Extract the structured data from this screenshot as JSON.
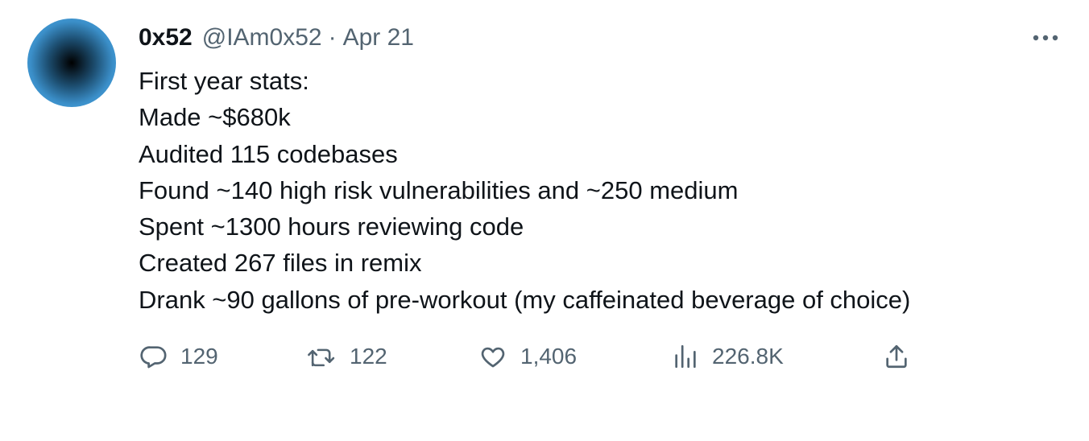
{
  "tweet": {
    "display_name": "0x52",
    "handle": "@IAm0x52",
    "separator": "·",
    "date": "Apr 21",
    "more_label": "···",
    "lines": [
      "First year stats:",
      "Made ~$680k",
      "Audited 115 codebases",
      "Found ~140 high risk vulnerabilities and ~250 medium",
      "Spent ~1300 hours reviewing code",
      "Created 267 files in remix",
      "Drank ~90 gallons of pre-workout (my caffeinated beverage of choice)"
    ],
    "actions": {
      "replies": "129",
      "retweets": "122",
      "likes": "1,406",
      "views": "226.8K"
    },
    "icons": {
      "reply": "reply-icon",
      "retweet": "retweet-icon",
      "like": "heart-icon",
      "views": "views-chart-icon",
      "share": "share-icon",
      "more": "more-icon"
    },
    "colors": {
      "text": "#0f1419",
      "secondary": "#536471",
      "avatar_edge": "#52b0ea"
    }
  }
}
